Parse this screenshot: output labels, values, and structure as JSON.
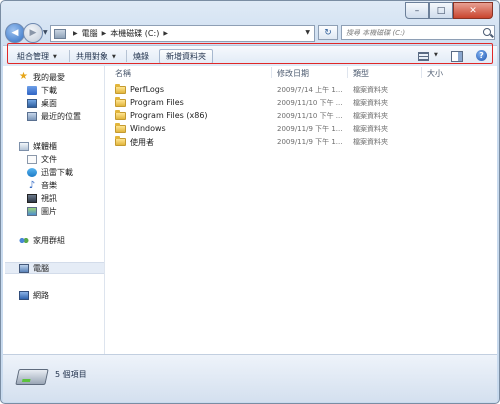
{
  "window": {
    "minimize": "–",
    "maximize": "□",
    "close": "✕"
  },
  "address": {
    "crumbs": [
      "電腦",
      "本機磁碟 (C:)"
    ],
    "refresh": "↻"
  },
  "search": {
    "placeholder": "搜尋 本機磁碟 (C:)"
  },
  "toolbar": {
    "organize": "組合管理",
    "share": "共用對象",
    "burn": "燒錄",
    "new_folder": "新增資料夾",
    "help": "?"
  },
  "navpane": {
    "favorites": "我的最愛",
    "downloads": "下載",
    "desktop": "桌面",
    "recent": "最近的位置",
    "libraries": "媒體櫃",
    "documents": "文件",
    "thunder": "迅雷下載",
    "music": "音樂",
    "videos": "視訊",
    "pictures": "圖片",
    "homegroup": "家用群組",
    "computer": "電腦",
    "network": "網路"
  },
  "columns": {
    "name": "名稱",
    "date": "修改日期",
    "type": "類型",
    "size": "大小"
  },
  "files": [
    {
      "name": "PerfLogs",
      "date": "2009/7/14 上午 1...",
      "type": "檔案資料夾"
    },
    {
      "name": "Program Files",
      "date": "2009/11/10 下午 ...",
      "type": "檔案資料夾"
    },
    {
      "name": "Program Files (x86)",
      "date": "2009/11/10 下午 ...",
      "type": "檔案資料夾"
    },
    {
      "name": "Windows",
      "date": "2009/11/9 下午 1...",
      "type": "檔案資料夾"
    },
    {
      "name": "使用者",
      "date": "2009/11/9 下午 1...",
      "type": "檔案資料夾"
    }
  ],
  "status": {
    "item_count": "5 個項目"
  }
}
